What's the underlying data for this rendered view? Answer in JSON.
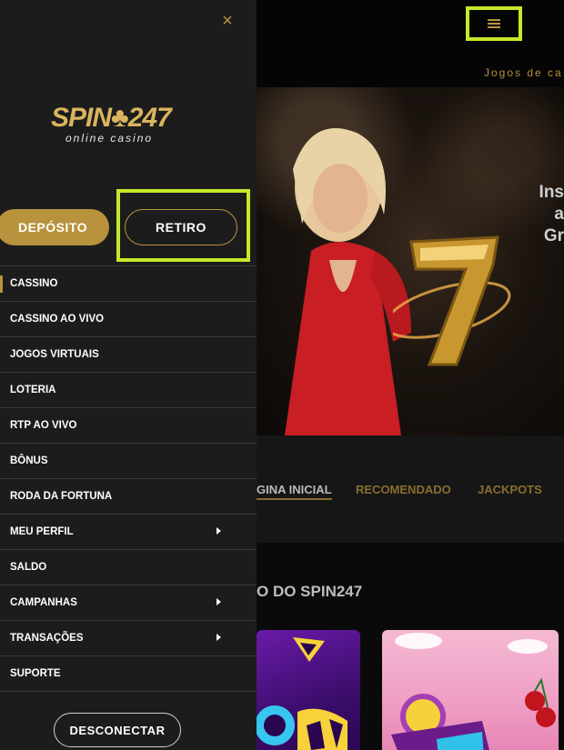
{
  "drawer": {
    "close_icon": "×",
    "logo_text": "SPIN♣247",
    "logo_tagline": "online casino",
    "deposit_label": "DEPÓSITO",
    "withdraw_label": "RETIRO",
    "menu": [
      {
        "label": "CASSINO",
        "active": true,
        "submenu": false
      },
      {
        "label": "CASSINO AO VIVO",
        "submenu": false
      },
      {
        "label": "JOGOS VIRTUAIS",
        "submenu": false
      },
      {
        "label": "LOTERIA",
        "submenu": false
      },
      {
        "label": "RTP AO VIVO",
        "submenu": false
      },
      {
        "label": "BÔNUS",
        "submenu": false
      },
      {
        "label": "RODA DA FORTUNA",
        "submenu": false
      },
      {
        "label": "MEU PERFIL",
        "submenu": true
      },
      {
        "label": "SALDO",
        "submenu": false
      },
      {
        "label": "CAMPANHAS",
        "submenu": true
      },
      {
        "label": "TRANSAÇÕES",
        "submenu": true
      },
      {
        "label": "SUPORTE",
        "submenu": false
      }
    ],
    "logout_label": "DESCONECTAR"
  },
  "header": {
    "menu_icon": "hamburger-icon",
    "subnav_text": "Jogos de ca"
  },
  "hero": {
    "line1": "Ins",
    "line2": "a",
    "line3": "Gr"
  },
  "tabs": [
    {
      "label": "GINA INICIAL",
      "active": true
    },
    {
      "label": "RECOMENDADO"
    },
    {
      "label": "JACKPOTS"
    }
  ],
  "section": {
    "title": "O DO SPIN247"
  },
  "colors": {
    "accent_gold": "#b8923c",
    "highlight_green": "#c4e92b",
    "drawer_bg": "#1c1c1c"
  }
}
